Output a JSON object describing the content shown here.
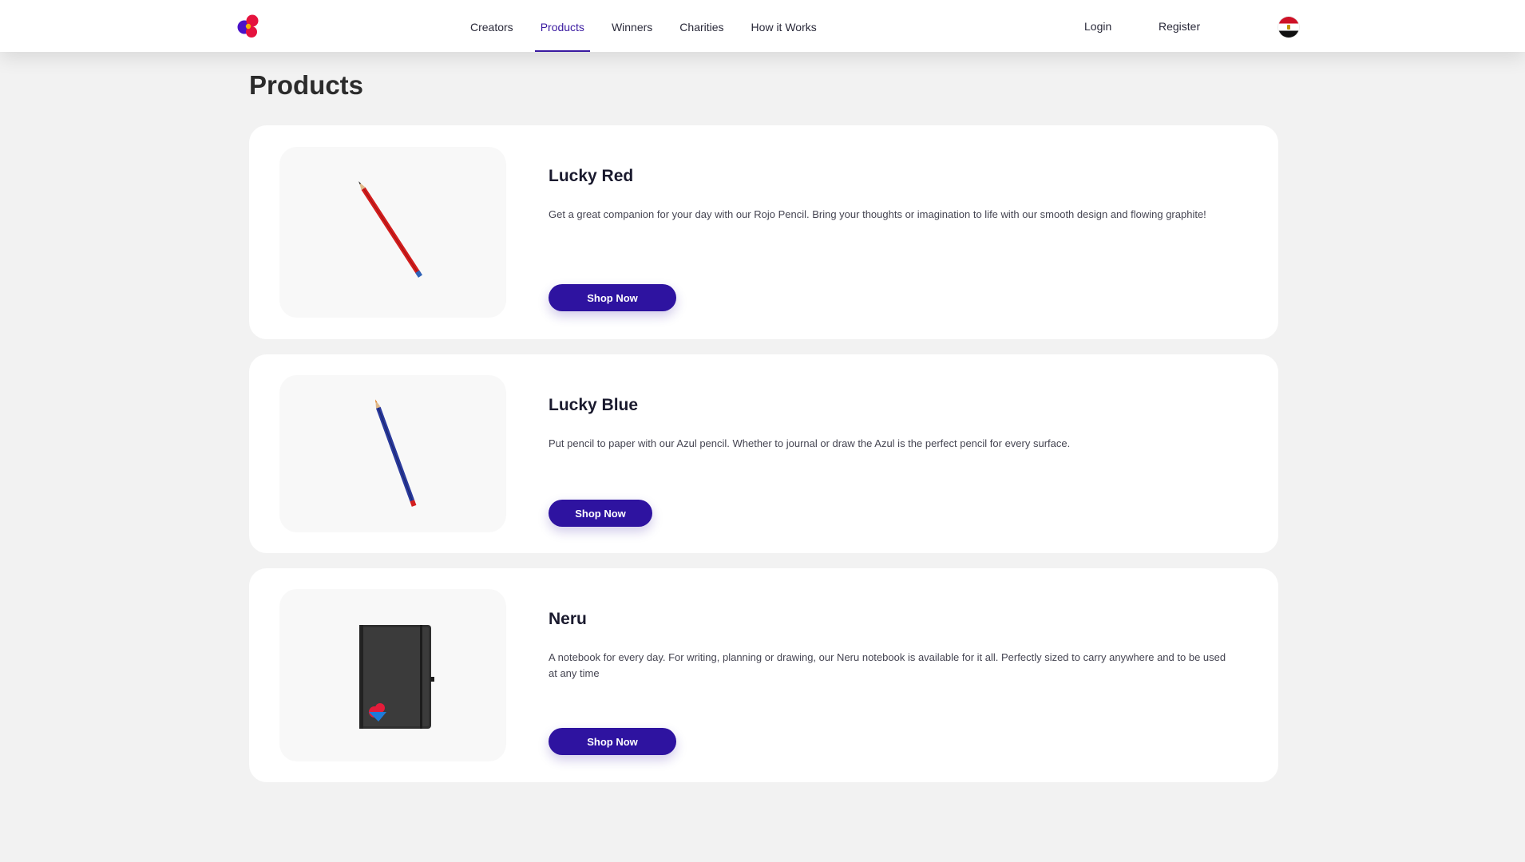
{
  "header": {
    "logo_icon": "brand-logo-icon",
    "nav": [
      {
        "label": "Creators",
        "active": false
      },
      {
        "label": "Products",
        "active": true
      },
      {
        "label": "Winners",
        "active": false
      },
      {
        "label": "Charities",
        "active": false
      },
      {
        "label": "How it Works",
        "active": false
      }
    ],
    "login_label": "Login",
    "register_label": "Register",
    "flag_icon": "egypt-flag-icon"
  },
  "main": {
    "title": "Products",
    "products": [
      {
        "name": "Lucky Red",
        "description": "Get a great companion for your day with our Rojo Pencil. Bring your thoughts or imagination to life with our smooth design and flowing graphite!",
        "button_label": "Shop Now",
        "image_icon": "red-pencil-image"
      },
      {
        "name": "Lucky Blue",
        "description": "Put pencil to paper with our Azul pencil. Whether to journal or draw the Azul is the perfect pencil for every surface.",
        "button_label": "Shop Now",
        "image_icon": "blue-pencil-image"
      },
      {
        "name": "Neru",
        "description": "A notebook for every day. For writing, planning or drawing, our Neru notebook is available for it all. Perfectly sized to carry anywhere and to be used at any time",
        "button_label": "Shop Now",
        "image_icon": "notebook-image"
      }
    ]
  },
  "colors": {
    "accent": "#2e13a0",
    "background": "#f2f2f2",
    "card": "#ffffff"
  }
}
